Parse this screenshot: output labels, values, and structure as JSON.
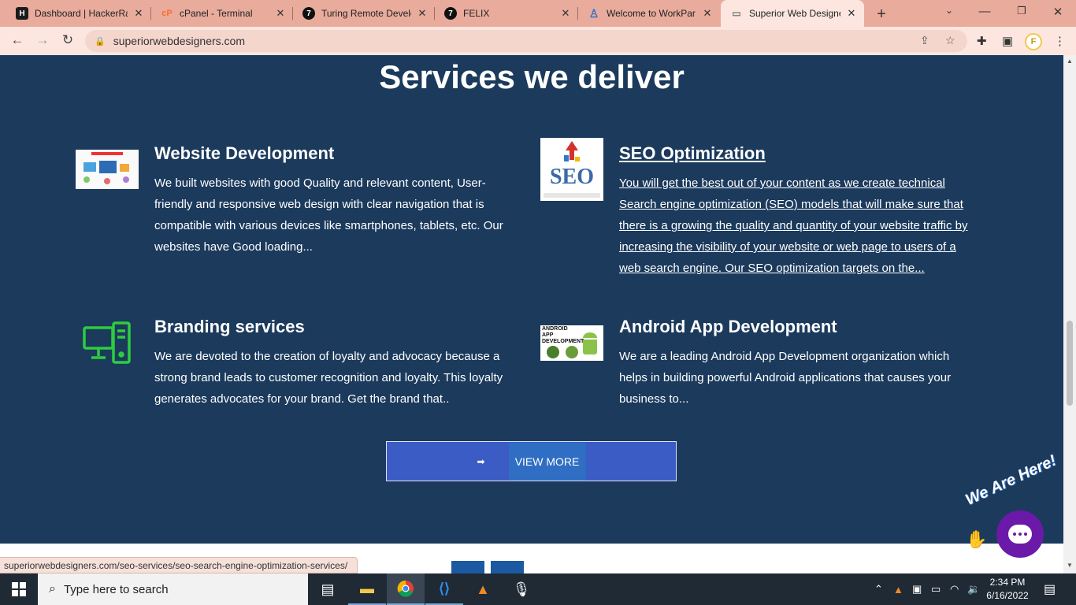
{
  "browser": {
    "tabs": [
      {
        "title": "Dashboard | HackerRa",
        "icon": "hackerrank-icon"
      },
      {
        "title": "cPanel - Terminal",
        "icon": "cpanel-icon"
      },
      {
        "title": "Turing Remote Develo",
        "icon": "turing-icon"
      },
      {
        "title": "FELIX",
        "icon": "turing-icon"
      },
      {
        "title": "Welcome to WorkPar",
        "icon": "workpar-icon"
      },
      {
        "title": "Superior Web Designe",
        "icon": "superior-icon",
        "active": true
      }
    ],
    "url": "superiorwebdesigners.com",
    "profile_initial": "F",
    "status_url": "superiorwebdesigners.com/seo-services/seo-search-engine-optimization-services/"
  },
  "page": {
    "heading": "Services we deliver",
    "services": [
      {
        "title": "Website Development",
        "desc_lines": [
          "We built websites with good Quality and relevant content, User-",
          "friendly and responsive web design with clear navigation that is",
          "compatible with various devices like smartphones, tablets, etc. Our",
          "websites have Good loading..."
        ],
        "image": "web-development-services-image"
      },
      {
        "title": "SEO Optimization",
        "desc_lines": [
          "You will get the best out of your content as we create technical",
          "Search engine optimization (SEO) models that will make sure that",
          "there is a growing the quality and quantity of your website traffic by",
          "increasing the visibility of your website or web page to users of a",
          "web search engine. Our SEO optimization targets on the..."
        ],
        "image": "seo-image",
        "image_text": "SEO"
      },
      {
        "title": "Branding services",
        "desc_lines": [
          "We are devoted to the creation of loyalty and advocacy because a",
          "strong brand leads to customer recognition and loyalty. This loyalty",
          "generates advocates for your brand. Get the brand that.."
        ],
        "image": "computer-icon"
      },
      {
        "title": "Android App Development",
        "desc_lines": [
          "We are a leading Android App Development organization which",
          "helps in building powerful Android applications that causes your",
          "business to..."
        ],
        "image": "android-app-image",
        "image_text": "ANDROID APP DEVELOPMENT"
      }
    ],
    "view_more": "VIEW MORE",
    "chat_banner": "We Are Here!"
  },
  "taskbar": {
    "search_placeholder": "Type here to search",
    "time": "2:34 PM",
    "date": "6/16/2022"
  },
  "colors": {
    "page_bg": "#1b3a5c",
    "button_bg": "#3b5cc4",
    "chat_bg": "#6b19a8",
    "tabstrip_bg": "#e8ab9c"
  }
}
